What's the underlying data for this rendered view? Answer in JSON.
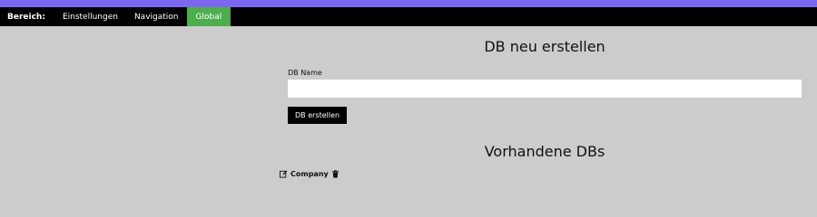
{
  "colors": {
    "accent_bar": "#7b68ee",
    "nav_background": "#000000",
    "nav_active": "#4cae4c",
    "page_background": "#cccccc"
  },
  "nav": {
    "label": "Bereich:",
    "items": [
      {
        "label": "Einstellungen",
        "active": false
      },
      {
        "label": "Navigation",
        "active": false
      },
      {
        "label": "Global",
        "active": true
      }
    ]
  },
  "create_section": {
    "title": "DB neu erstellen",
    "field_label": "DB Name",
    "field_value": "",
    "button_label": "DB erstellen"
  },
  "existing_section": {
    "title": "Vorhandene DBs",
    "databases": [
      {
        "name": "Company",
        "edit_icon": "edit-icon",
        "delete_icon": "trash-icon"
      }
    ]
  }
}
